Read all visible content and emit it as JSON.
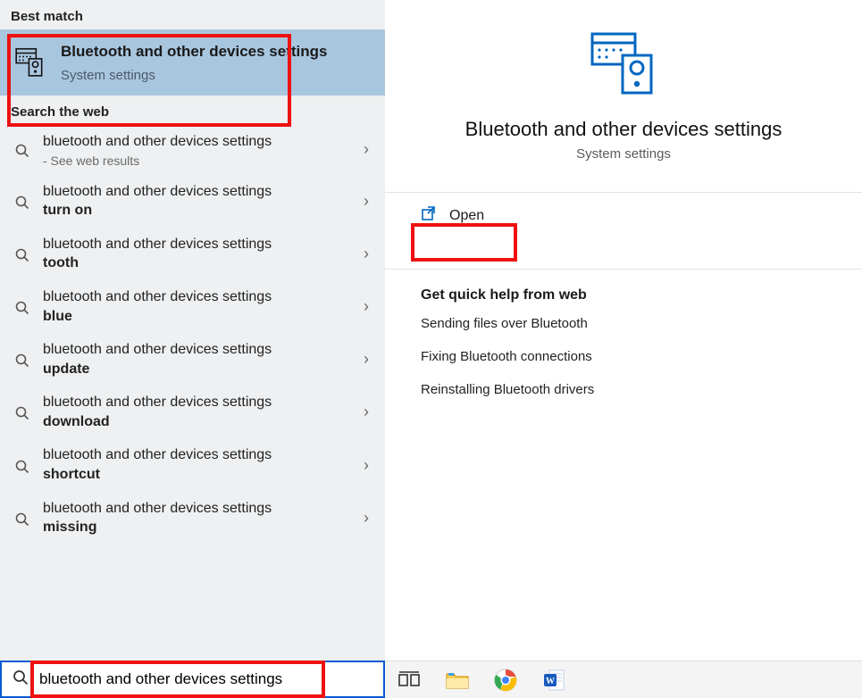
{
  "left": {
    "best_match_header": "Best match",
    "best_match": {
      "title": "Bluetooth and other devices settings",
      "subtitle": "System settings"
    },
    "search_web_header": "Search the web",
    "web_results": [
      {
        "base": "bluetooth and other devices settings",
        "suffix": "",
        "sub": "- See web results"
      },
      {
        "base": "bluetooth and other devices settings",
        "suffix": "turn on",
        "sub": ""
      },
      {
        "base": "bluetooth and other devices settings",
        "suffix": "tooth",
        "sub": ""
      },
      {
        "base": "bluetooth and other devices settings",
        "suffix": "blue",
        "sub": ""
      },
      {
        "base": "bluetooth and other devices settings",
        "suffix": "update",
        "sub": ""
      },
      {
        "base": "bluetooth and other devices settings",
        "suffix": "download",
        "sub": ""
      },
      {
        "base": "bluetooth and other devices settings",
        "suffix": "shortcut",
        "sub": ""
      },
      {
        "base": "bluetooth and other devices settings",
        "suffix": "missing",
        "sub": ""
      }
    ]
  },
  "right": {
    "title": "Bluetooth and other devices settings",
    "subtitle": "System settings",
    "open_label": "Open",
    "help_header": "Get quick help from web",
    "help_links": [
      "Sending files over Bluetooth",
      "Fixing Bluetooth connections",
      "Reinstalling Bluetooth drivers"
    ]
  },
  "search": {
    "value": "bluetooth and other devices settings"
  },
  "taskbar_icons": [
    "task-view-icon",
    "file-explorer-icon",
    "chrome-icon",
    "word-icon"
  ]
}
